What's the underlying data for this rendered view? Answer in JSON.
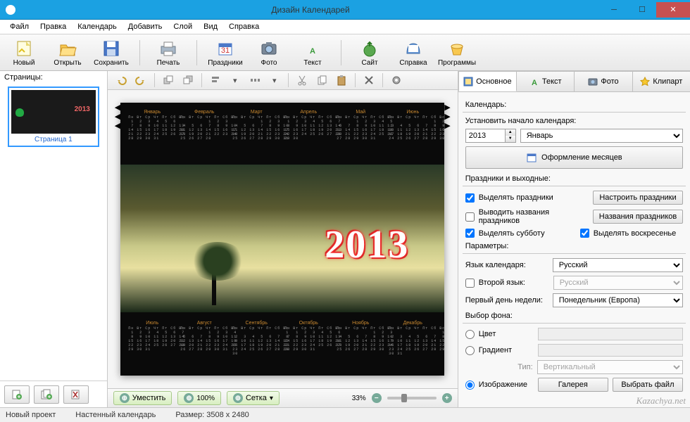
{
  "title": "Дизайн Календарей",
  "menu": [
    "Файл",
    "Правка",
    "Календарь",
    "Добавить",
    "Слой",
    "Вид",
    "Справка"
  ],
  "toolbar": [
    {
      "label": "Новый",
      "icon": "new"
    },
    {
      "label": "Открыть",
      "icon": "open"
    },
    {
      "label": "Сохранить",
      "icon": "save",
      "dd": true
    },
    {
      "label": "Печать",
      "icon": "print"
    },
    {
      "label": "Праздники",
      "icon": "holidays"
    },
    {
      "label": "Фото",
      "icon": "photo"
    },
    {
      "label": "Текст",
      "icon": "text"
    },
    {
      "label": "Сайт",
      "icon": "site"
    },
    {
      "label": "Справка",
      "icon": "help"
    },
    {
      "label": "Программы",
      "icon": "apps"
    }
  ],
  "toolbar_seps": [
    3,
    6
  ],
  "pages": {
    "header": "Страницы:",
    "items": [
      {
        "caption": "Страница 1"
      }
    ]
  },
  "canvas": {
    "year": "2013",
    "months_top": [
      "Январь",
      "Февраль",
      "Март",
      "Апрель",
      "Май",
      "Июнь"
    ],
    "months_bot": [
      "Июль",
      "Август",
      "Сентябрь",
      "Октябрь",
      "Ноябрь",
      "Декабрь"
    ]
  },
  "centerbottom": {
    "fit": "Уместить",
    "pct100": "100%",
    "grid": "Сетка",
    "zoom": "33%"
  },
  "tabs": [
    {
      "label": "Основное",
      "icon": "main",
      "active": true
    },
    {
      "label": "Текст",
      "icon": "text"
    },
    {
      "label": "Фото",
      "icon": "photo"
    },
    {
      "label": "Клипарт",
      "icon": "clipart"
    }
  ],
  "panel": {
    "g_calendar": "Календарь:",
    "set_start": "Установить начало календаря:",
    "year": "2013",
    "month": "Январь",
    "months_design_btn": "Оформление месяцев",
    "g_holidays": "Праздники и выходные:",
    "chk_highlight_h": "Выделять праздники",
    "btn_setup_h": "Настроить праздники",
    "chk_show_names": "Выводить названия праздников",
    "btn_names": "Названия праздников",
    "chk_sat": "Выделять субботу",
    "chk_sun": "Выделять воскресенье",
    "g_params": "Параметры:",
    "lang_lbl": "Язык календаря:",
    "lang_val": "Русский",
    "lang2_lbl": "Второй язык:",
    "lang2_val": "Русский",
    "firstday_lbl": "Первый день недели:",
    "firstday_val": "Понедельник (Европа)",
    "g_bg": "Выбор фона:",
    "r_color": "Цвет",
    "r_gradient": "Градиент",
    "grad_type_lbl": "Тип:",
    "grad_type_val": "Вертикальный",
    "r_image": "Изображение",
    "btn_gallery": "Галерея",
    "btn_pickfile": "Выбрать файл"
  },
  "status": {
    "project": "Новый проект",
    "kind": "Настенный календарь",
    "size": "Размер: 3508 х 2480"
  },
  "watermark": "Kazachya.net"
}
